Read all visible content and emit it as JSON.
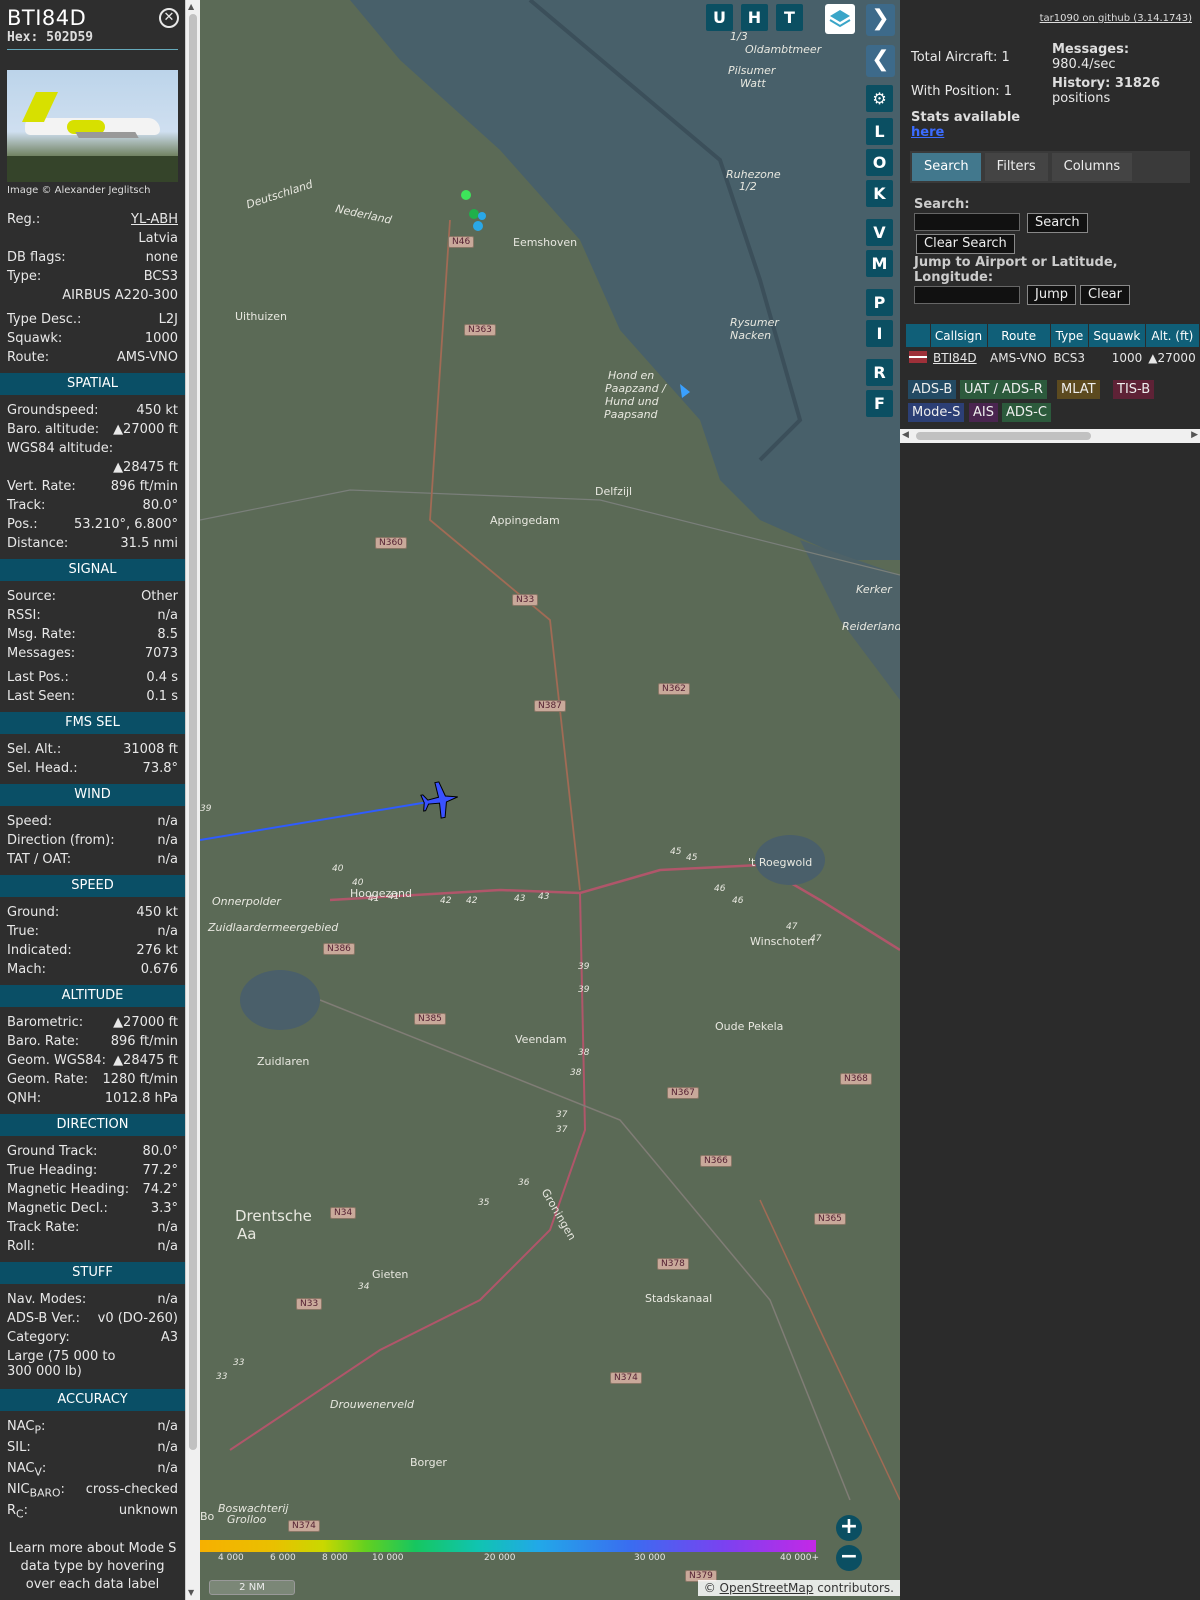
{
  "aircraft": {
    "callsign": "BTI84D",
    "hex": "Hex: 502D59",
    "image_credit": "Image © Alexander Jeglitsch"
  },
  "info": [
    {
      "label": "Reg.:",
      "value": "YL-ABH"
    },
    {
      "label": "",
      "value": "Latvia"
    },
    {
      "label": "DB flags:",
      "value": "none"
    },
    {
      "label": "Type:",
      "value": "BCS3"
    },
    {
      "label": "",
      "value": "AIRBUS A220-300"
    },
    {
      "label": "Type Desc.:",
      "value": "L2J"
    },
    {
      "label": "Squawk:",
      "value": "1000"
    },
    {
      "label": "Route:",
      "value": "AMS-VNO"
    }
  ],
  "sections": [
    {
      "title": "SPATIAL",
      "rows": [
        {
          "label": "Groundspeed:",
          "value": "450 kt"
        },
        {
          "label": "Baro. altitude:",
          "value": "▲27000 ft"
        },
        {
          "label": "WGS84 altitude:",
          "value": ""
        },
        {
          "label": "",
          "value": "▲28475 ft"
        },
        {
          "label": "Vert. Rate:",
          "value": "896 ft/min"
        },
        {
          "label": "Track:",
          "value": "80.0°"
        },
        {
          "label": "Pos.:",
          "value": "53.210°, 6.800°"
        },
        {
          "label": "Distance:",
          "value": "31.5 nmi"
        }
      ]
    },
    {
      "title": "SIGNAL",
      "rows": [
        {
          "label": "Source:",
          "value": "Other"
        },
        {
          "label": "RSSI:",
          "value": "n/a"
        },
        {
          "label": "Msg. Rate:",
          "value": "8.5"
        },
        {
          "label": "Messages:",
          "value": "7073"
        },
        {
          "label": "Last Pos.:",
          "value": "0.4 s"
        },
        {
          "label": "Last Seen:",
          "value": "0.1 s"
        }
      ]
    },
    {
      "title": "FMS SEL",
      "rows": [
        {
          "label": "Sel. Alt.:",
          "value": "31008 ft"
        },
        {
          "label": "Sel. Head.:",
          "value": "73.8°"
        }
      ]
    },
    {
      "title": "WIND",
      "rows": [
        {
          "label": "Speed:",
          "value": "n/a"
        },
        {
          "label": "Direction (from):",
          "value": "n/a"
        },
        {
          "label": "TAT / OAT:",
          "value": "n/a"
        }
      ]
    },
    {
      "title": "SPEED",
      "rows": [
        {
          "label": "Ground:",
          "value": "450 kt"
        },
        {
          "label": "True:",
          "value": "n/a"
        },
        {
          "label": "Indicated:",
          "value": "276 kt"
        },
        {
          "label": "Mach:",
          "value": "0.676"
        }
      ]
    },
    {
      "title": "ALTITUDE",
      "rows": [
        {
          "label": "Barometric:",
          "value": "▲27000 ft"
        },
        {
          "label": "Baro. Rate:",
          "value": "896 ft/min"
        },
        {
          "label": "Geom. WGS84:",
          "value": "▲28475 ft"
        },
        {
          "label": "Geom. Rate:",
          "value": "1280 ft/min"
        },
        {
          "label": "QNH:",
          "value": "1012.8 hPa"
        }
      ]
    },
    {
      "title": "DIRECTION",
      "rows": [
        {
          "label": "Ground Track:",
          "value": "80.0°"
        },
        {
          "label": "True Heading:",
          "value": "77.2°"
        },
        {
          "label": "Magnetic Heading:",
          "value": "74.2°"
        },
        {
          "label": "Magnetic Decl.:",
          "value": "3.3°"
        },
        {
          "label": "Track Rate:",
          "value": "n/a"
        },
        {
          "label": "Roll:",
          "value": "n/a"
        }
      ]
    },
    {
      "title": "STUFF",
      "rows": [
        {
          "label": "Nav. Modes:",
          "value": "n/a"
        },
        {
          "label": "ADS-B Ver.:",
          "value": "v0 (DO-260)"
        },
        {
          "label": "Category:",
          "value": "A3"
        }
      ]
    }
  ],
  "category_desc_1": "Large (75 000 to",
  "category_desc_2": "300 000 lb)",
  "accuracy": {
    "title": "ACCURACY",
    "nacp_base": "NAC",
    "nacp_sub": "P",
    "nacp_value": "n/a",
    "sil_label": "SIL:",
    "sil_value": "n/a",
    "nacv_base": "NAC",
    "nacv_sub": "V",
    "nacv_value": "n/a",
    "nicbaro_base": "NIC",
    "nicbaro_sub": "BARO",
    "nicbaro_value": "cross-checked",
    "rc_base": "R",
    "rc_sub": "C",
    "rc_value": "unknown"
  },
  "learn_more": "Learn more about Mode S data type by hovering over each data label",
  "map": {
    "buttons_top": [
      "U",
      "H",
      "T"
    ],
    "buttons_side": [
      "L",
      "O",
      "K",
      "V",
      "M",
      "P",
      "I",
      "R",
      "F"
    ],
    "places": [
      "Uithuizen",
      "Eemshoven",
      "Appingedam",
      "Delfzijl",
      "Hoogezand",
      "Winschoten",
      "Veendam",
      "Oude Pekela",
      "Zuidlaren",
      "Gieten",
      "Stadskanaal",
      "Borger",
      "Drentsche",
      "Aa",
      "Deutschland",
      "Nederland",
      "Hond en",
      "Paapzand /",
      "Hund und",
      "Paapsand",
      "Rysumer",
      "Nacken",
      "Pilsumer",
      "Watt",
      "Ruhezone",
      "1/2",
      "1/3",
      "Oldambtmeer",
      "'t Roegwold",
      "Onnerpolder",
      "Zuidlaardermeergebied",
      "Drouwenerveld",
      "Boswachterij",
      "Grolloo",
      "Kerker",
      "Reiderland",
      "Groningen",
      "Bo"
    ],
    "roads": [
      "N46",
      "N363",
      "N360",
      "N33",
      "N387",
      "N362",
      "N386",
      "N385",
      "N367",
      "N366",
      "N368",
      "N34",
      "N33",
      "N378",
      "N365",
      "N374",
      "N374",
      "N379"
    ],
    "road_numbers": [
      "39",
      "40",
      "40",
      "41",
      "41",
      "42",
      "42",
      "43",
      "43",
      "45",
      "45",
      "46",
      "46",
      "47",
      "47",
      "39",
      "39",
      "38",
      "38",
      "37",
      "37",
      "36",
      "35",
      "34",
      "33",
      "33"
    ],
    "colorbar_labels": [
      "4 000",
      "6 000",
      "8 000",
      "10 000",
      "20 000",
      "30 000",
      "40 000+"
    ],
    "scale": "2 NM",
    "attribution_prefix": "© ",
    "attribution_link": "OpenStreetMap",
    "attribution_suffix": " contributors."
  },
  "panel": {
    "github": "tar1090 on github (3.14.1743)",
    "total_aircraft": "Total Aircraft: 1",
    "with_position": "With Position: 1",
    "messages_label": "Messages:",
    "messages_value": "980.4/sec",
    "history_label": "History: 31826",
    "history_value": "positions",
    "stats_available": "Stats available",
    "stats_link": "here",
    "tabs": [
      "Search",
      "Filters",
      "Columns"
    ],
    "search_label": "Search:",
    "search_btn": "Search",
    "clear_search_btn": "Clear Search",
    "jump_label": "Jump to Airport or Latitude, Longitude:",
    "jump_btn": "Jump",
    "clear_btn": "Clear",
    "table_headers": [
      "",
      "Callsign",
      "Route",
      "Type",
      "Squawk",
      "Alt. (ft)"
    ],
    "table_row": {
      "callsign": "BTI84D",
      "route": "AMS-VNO",
      "type": "BCS3",
      "squawk": "1000",
      "alt": "▲27000"
    },
    "legend": [
      {
        "label": "ADS-B",
        "bg": "#234a63"
      },
      {
        "label": "UAT / ADS-R",
        "bg": "#2c5a3c"
      },
      {
        "label": "MLAT",
        "bg": "#5c4a1f"
      },
      {
        "label": "TIS-B",
        "bg": "#5e2236"
      },
      {
        "label": "Mode-S",
        "bg": "#2c3f75"
      },
      {
        "label": "AIS",
        "bg": "#4a2550"
      },
      {
        "label": "ADS-C",
        "bg": "#2c5a3c"
      }
    ]
  },
  "colors": {
    "section": "#0a4f66",
    "button": "#0b4f62",
    "tab_active": "#42788d",
    "track": "#2f5cff"
  }
}
